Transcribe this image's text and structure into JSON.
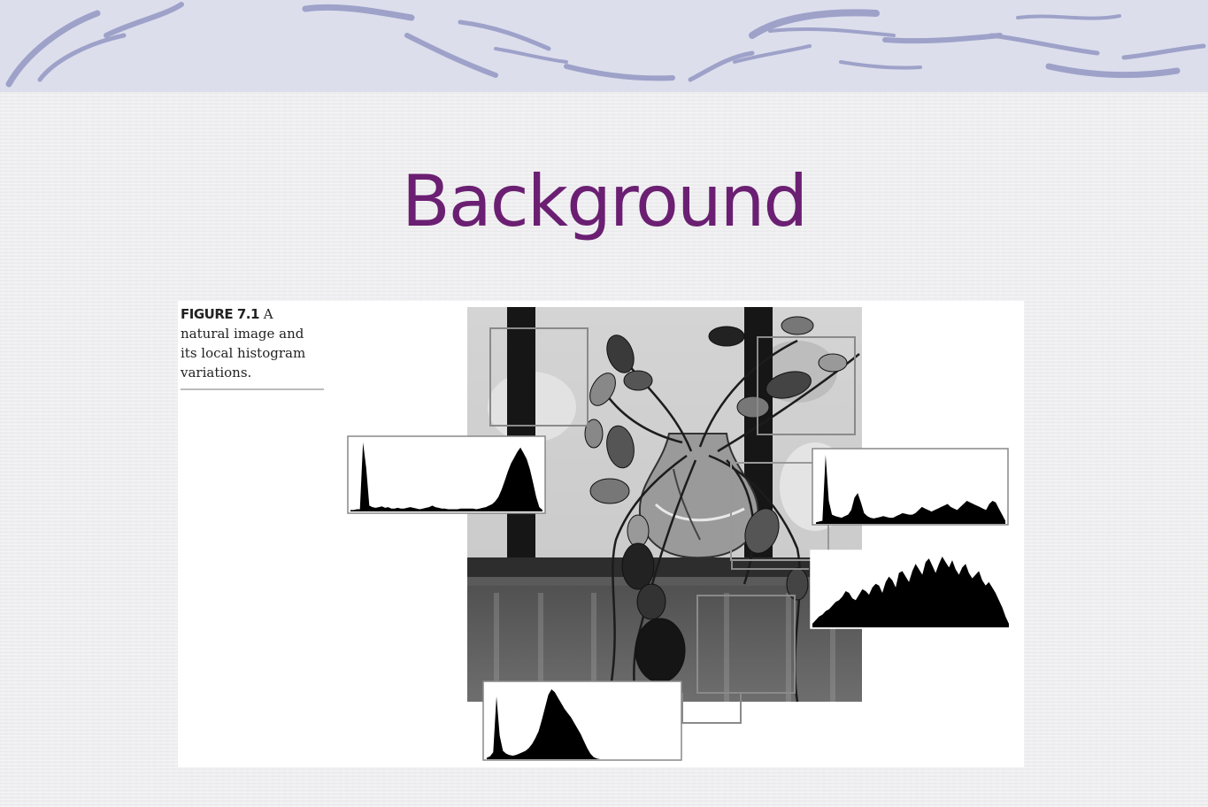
{
  "slide": {
    "title": "Background"
  },
  "figure": {
    "label": "FIGURE 7.1",
    "caption": "A natural image and its local histogram variations.",
    "histograms": [
      {
        "name": "top-left-window",
        "heights": [
          2,
          2,
          3,
          3,
          95,
          60,
          8,
          6,
          5,
          6,
          7,
          5,
          6,
          4,
          4,
          5,
          4,
          4,
          5,
          6,
          5,
          4,
          3,
          4,
          5,
          6,
          8,
          6,
          5,
          4,
          4,
          3,
          3,
          3,
          3,
          4,
          4,
          4,
          4,
          4,
          3,
          4,
          5,
          6,
          8,
          10,
          14,
          20,
          30,
          42,
          55,
          66,
          74,
          82,
          88,
          80,
          72,
          58,
          40,
          20,
          6,
          2
        ]
      },
      {
        "name": "right-upper-window",
        "heights": [
          2,
          3,
          4,
          90,
          30,
          12,
          10,
          9,
          8,
          10,
          12,
          18,
          34,
          40,
          28,
          14,
          10,
          8,
          7,
          8,
          9,
          10,
          9,
          8,
          8,
          10,
          12,
          14,
          13,
          12,
          12,
          14,
          18,
          22,
          20,
          18,
          16,
          18,
          20,
          22,
          24,
          26,
          22,
          20,
          18,
          22,
          26,
          30,
          28,
          26,
          24,
          22,
          20,
          18,
          26,
          30,
          28,
          20,
          12,
          4
        ]
      },
      {
        "name": "right-lower-window",
        "heights": [
          4,
          8,
          12,
          14,
          18,
          20,
          24,
          28,
          30,
          34,
          40,
          38,
          32,
          30,
          36,
          42,
          40,
          36,
          44,
          48,
          46,
          38,
          50,
          56,
          52,
          44,
          60,
          62,
          56,
          50,
          62,
          70,
          64,
          58,
          72,
          76,
          68,
          60,
          70,
          78,
          72,
          66,
          74,
          64,
          58,
          66,
          70,
          60,
          54,
          58,
          62,
          52,
          46,
          50,
          44,
          38,
          30,
          22,
          12,
          4
        ]
      },
      {
        "name": "bottom-window",
        "heights": [
          2,
          4,
          10,
          90,
          34,
          12,
          8,
          6,
          5,
          6,
          8,
          10,
          12,
          16,
          22,
          30,
          40,
          56,
          74,
          92,
          100,
          96,
          88,
          80,
          72,
          66,
          60,
          52,
          44,
          36,
          26,
          16,
          8,
          3,
          1,
          0,
          0,
          0,
          0,
          0,
          0,
          0,
          0,
          0,
          0,
          0,
          0,
          0,
          0,
          0,
          0,
          0,
          0,
          0,
          0,
          0,
          0,
          0,
          0,
          0
        ]
      }
    ]
  },
  "colors": {
    "title": "#6b1f72",
    "banner_base": "#d9dbea",
    "banner_swirl": "#8f93bf"
  }
}
